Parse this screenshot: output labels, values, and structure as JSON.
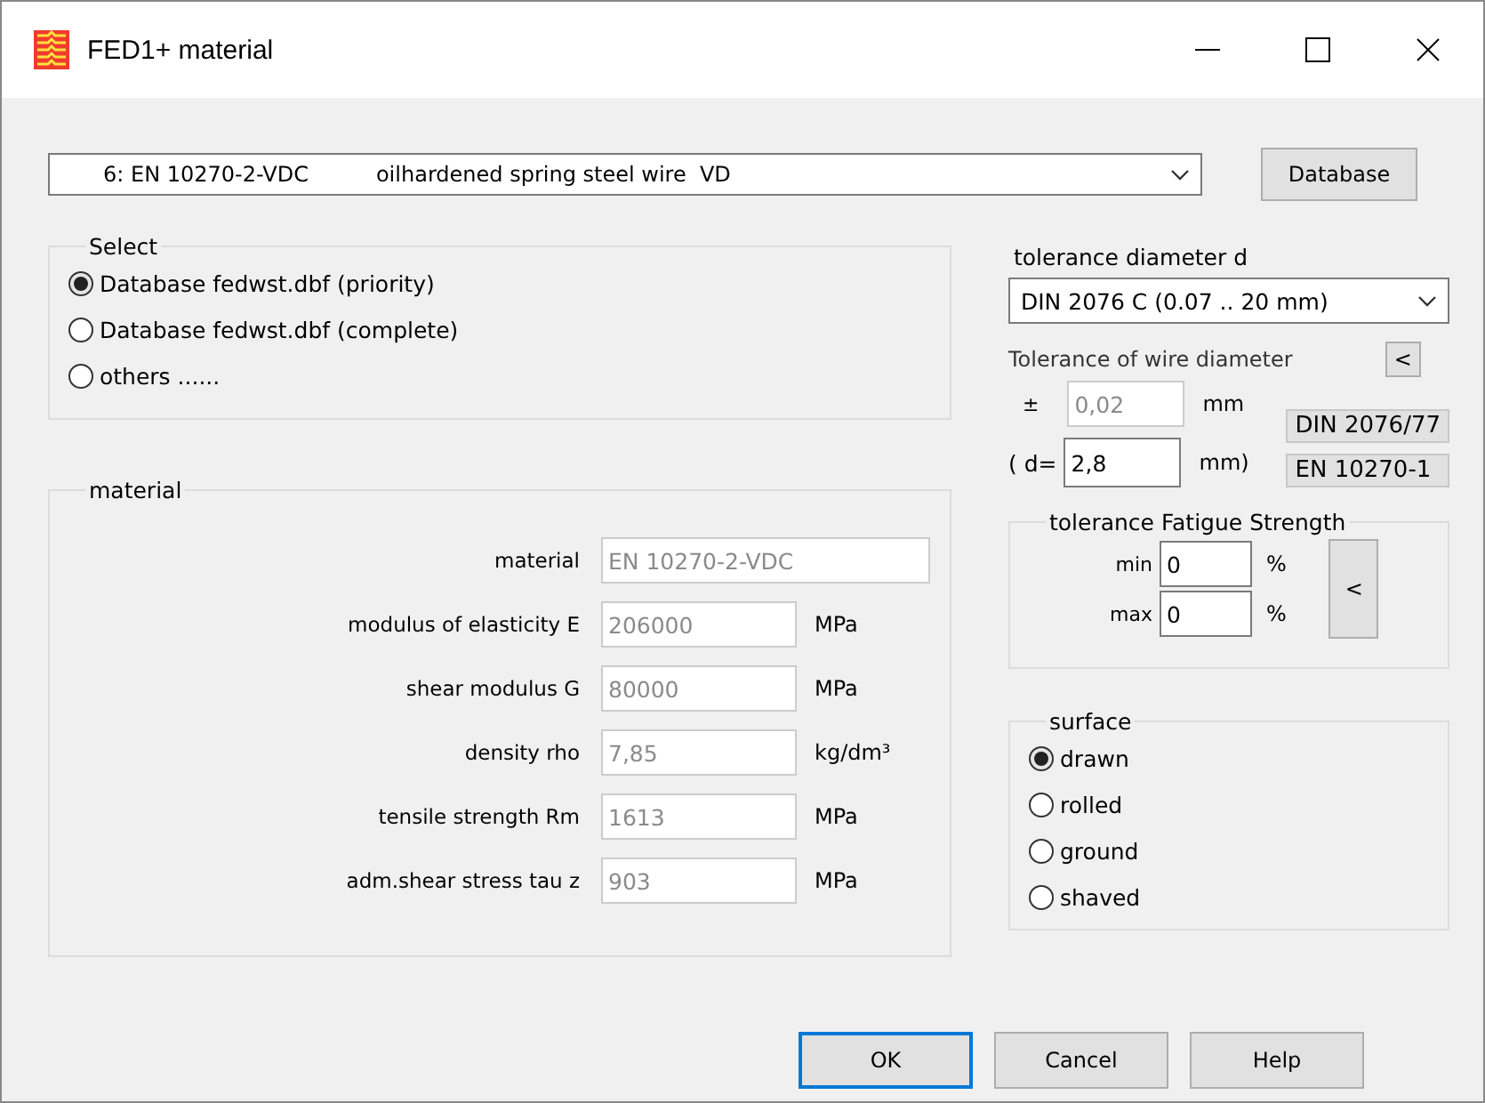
{
  "window": {
    "title": "FED1+ material"
  },
  "material_select": {
    "code": "6: EN 10270-2-VDC",
    "description": "oilhardened spring steel wire  VD"
  },
  "database_button": "Database",
  "select_group": {
    "legend": "Select",
    "options": [
      {
        "label": "Database fedwst.dbf (priority)",
        "selected": true
      },
      {
        "label": "Database fedwst.dbf (complete)",
        "selected": false
      },
      {
        "label": "others ......",
        "selected": false
      }
    ]
  },
  "material_group": {
    "legend": "material",
    "fields": [
      {
        "label": "material",
        "value": "EN 10270-2-VDC",
        "disabled": true,
        "wide": true
      },
      {
        "label": "modulus of elasticity E",
        "value": "206000",
        "unit": "MPa",
        "disabled": true,
        "wide": false
      },
      {
        "label": "shear modulus G",
        "value": "80000",
        "unit": "MPa",
        "disabled": true,
        "wide": false
      },
      {
        "label": "density rho",
        "value": "7,85",
        "unit": "kg/dm³",
        "disabled": true,
        "wide": false
      },
      {
        "label": "tensile strength Rm",
        "value": "1613",
        "unit": "MPa",
        "disabled": true,
        "wide": false
      },
      {
        "label": "adm.shear stress tau z",
        "value": "903",
        "unit": "MPa",
        "disabled": true,
        "wide": false
      }
    ]
  },
  "tolerance_diameter": {
    "label": "tolerance diameter d",
    "value": "DIN 2076 C (0.07 .. 20 mm)"
  },
  "wire_tolerance": {
    "label": "Tolerance of wire diameter",
    "back_button": "<",
    "sign": "±",
    "value": "0,02",
    "value_disabled": true,
    "unit": "mm",
    "d_prefix": "( d=",
    "d_value": "2,8",
    "d_unit": "mm)",
    "standards": [
      "DIN 2076/77",
      "EN 10270-1"
    ]
  },
  "fatigue_group": {
    "legend": "tolerance Fatigue Strength",
    "rows": [
      {
        "label": "min",
        "value": "0",
        "unit": "%"
      },
      {
        "label": "max",
        "value": "0",
        "unit": "%"
      }
    ],
    "back_button": "<"
  },
  "surface_group": {
    "legend": "surface",
    "options": [
      {
        "label": "drawn",
        "selected": true
      },
      {
        "label": "rolled",
        "selected": false
      },
      {
        "label": "ground",
        "selected": false
      },
      {
        "label": "shaved",
        "selected": false
      }
    ]
  },
  "buttons": [
    {
      "label": "OK",
      "default": true
    },
    {
      "label": "Cancel",
      "default": false
    },
    {
      "label": "Help",
      "default": false
    }
  ]
}
